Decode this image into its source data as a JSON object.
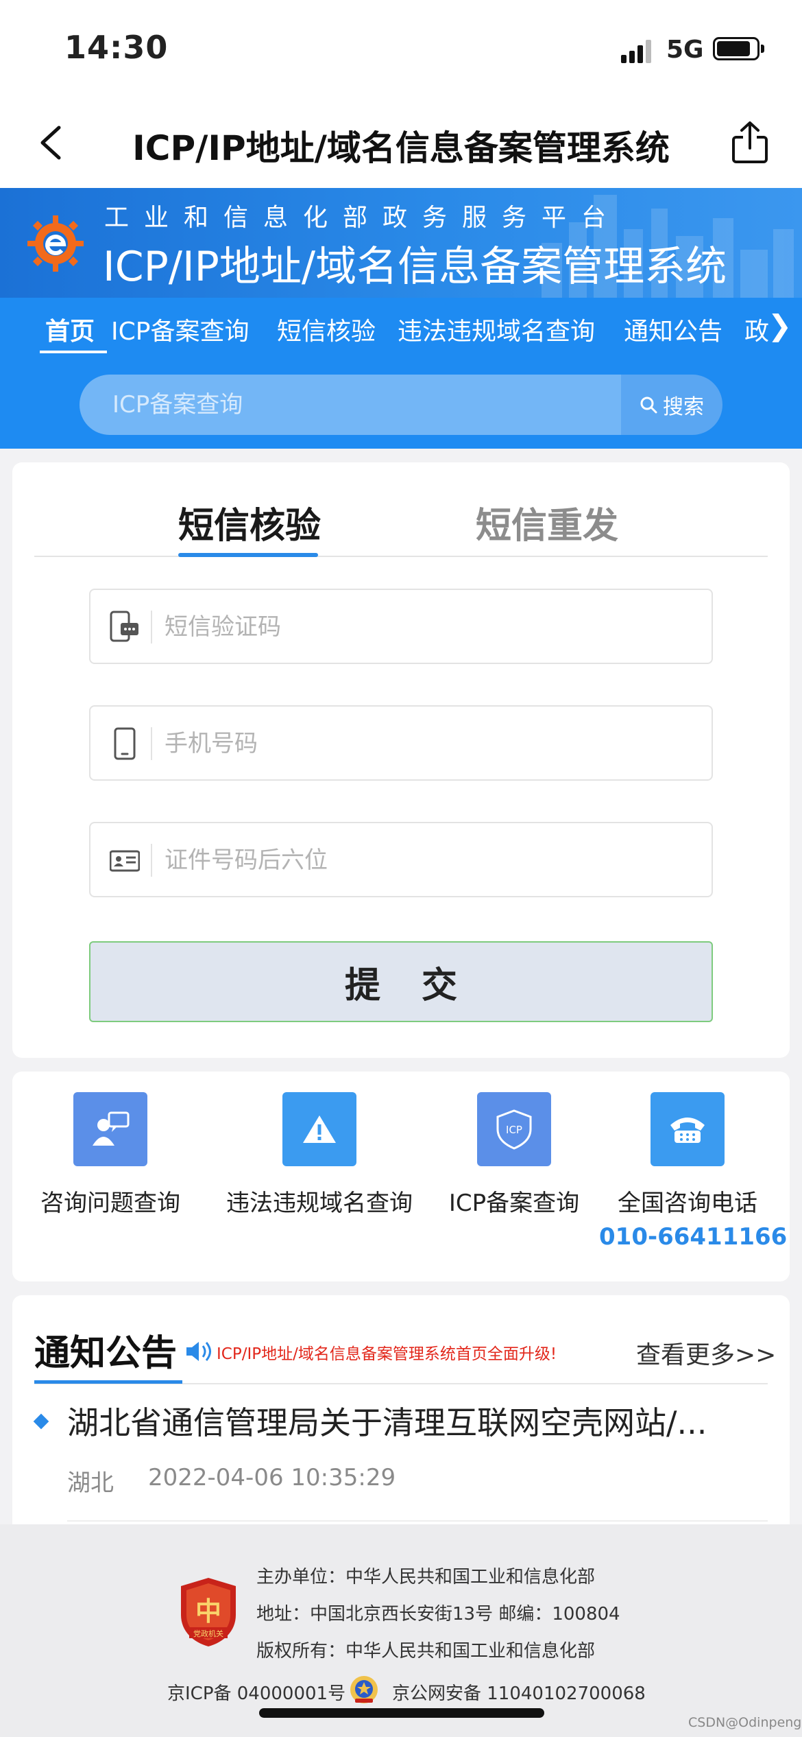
{
  "status_bar": {
    "time": "14:30",
    "network": "5G"
  },
  "nav": {
    "title": "ICP/IP地址/域名信息备案管理系统"
  },
  "banner": {
    "subtitle": "工业和信息化部政务服务平台",
    "title": "ICP/IP地址/域名信息备案管理系统"
  },
  "menu": {
    "items": [
      {
        "label": "首页"
      },
      {
        "label": "ICP备案查询"
      },
      {
        "label": "短信核验"
      },
      {
        "label": "违法违规域名查询"
      },
      {
        "label": "通知公告"
      },
      {
        "label": "政"
      }
    ],
    "more": "❯"
  },
  "search": {
    "placeholder": "ICP备案查询",
    "button": "搜索"
  },
  "form": {
    "tabs": [
      {
        "label": "短信核验"
      },
      {
        "label": "短信重发"
      }
    ],
    "fields": [
      {
        "placeholder": "短信验证码"
      },
      {
        "placeholder": "手机号码"
      },
      {
        "placeholder": "证件号码后六位"
      }
    ],
    "submit": "提交"
  },
  "services": {
    "items": [
      {
        "label": "咨询问题查询",
        "icon": "chat-icon",
        "color": "#5b8fe8"
      },
      {
        "label": "违法违规域名查询",
        "icon": "warning-icon",
        "color": "#3b9bf0"
      },
      {
        "label": "ICP备案查询",
        "icon": "icp-shield-icon",
        "color": "#5b8fe8"
      },
      {
        "label": "全国咨询电话",
        "icon": "telephone-icon",
        "color": "#3b9bf0"
      }
    ],
    "phone": "010-66411166"
  },
  "notice": {
    "title": "通知公告",
    "banner": "ICP/IP地址/域名信息备案管理系统首页全面升级!",
    "more": "查看更多>>",
    "items": [
      {
        "title": "湖北省通信管理局关于清理互联网空壳网站/...",
        "region": "湖北",
        "date": "2022-04-06 10:35:29"
      }
    ]
  },
  "footer": {
    "lines": [
      "主办单位：中华人民共和国工业和信息化部",
      "地址：中国北京西长安街13号 邮编：100804",
      "版权所有：中华人民共和国工业和信息化部"
    ],
    "icp": "京ICP备 04000001号",
    "police": "京公网安备 11040102700068",
    "emblem_text": "党政机关"
  },
  "watermark": "CSDN@Odinpeng",
  "colors": {
    "primary": "#1e8bf2",
    "accent": "#2a8ae8",
    "notice_red": "#e2271b"
  }
}
